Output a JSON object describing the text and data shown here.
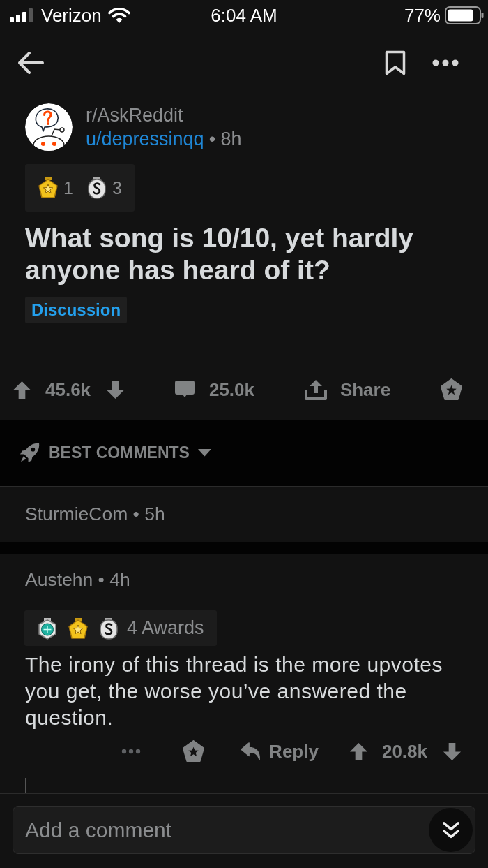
{
  "status_bar": {
    "carrier": "Verizon",
    "time": "6:04 AM",
    "battery": "77%"
  },
  "post": {
    "subreddit": "r/AskReddit",
    "author": "u/depressinqq",
    "age": "• 8h",
    "awards": [
      {
        "kind": "star",
        "count": "1"
      },
      {
        "kind": "coin",
        "count": "3"
      }
    ],
    "title": "What song is 10/10, yet hardly anyone has heard of it?",
    "flair": "Discussion",
    "score": "45.6k",
    "comments": "25.0k",
    "share": "Share"
  },
  "sort": {
    "label": "BEST COMMENTS"
  },
  "comments": [
    {
      "byline": "SturmieCom • 5h",
      "collapsed": true
    },
    {
      "byline": "Austehn • 4h",
      "collapsed": false,
      "awards": [
        {
          "kind": "gem"
        },
        {
          "kind": "star"
        },
        {
          "kind": "coin"
        }
      ],
      "awards_label": "4 Awards",
      "body": "The irony of this thread is the more upvotes you get, the worse you’ve answered the question.",
      "reply": "Reply",
      "score": "20.8k"
    }
  ],
  "composer": {
    "placeholder": "Add a comment"
  }
}
